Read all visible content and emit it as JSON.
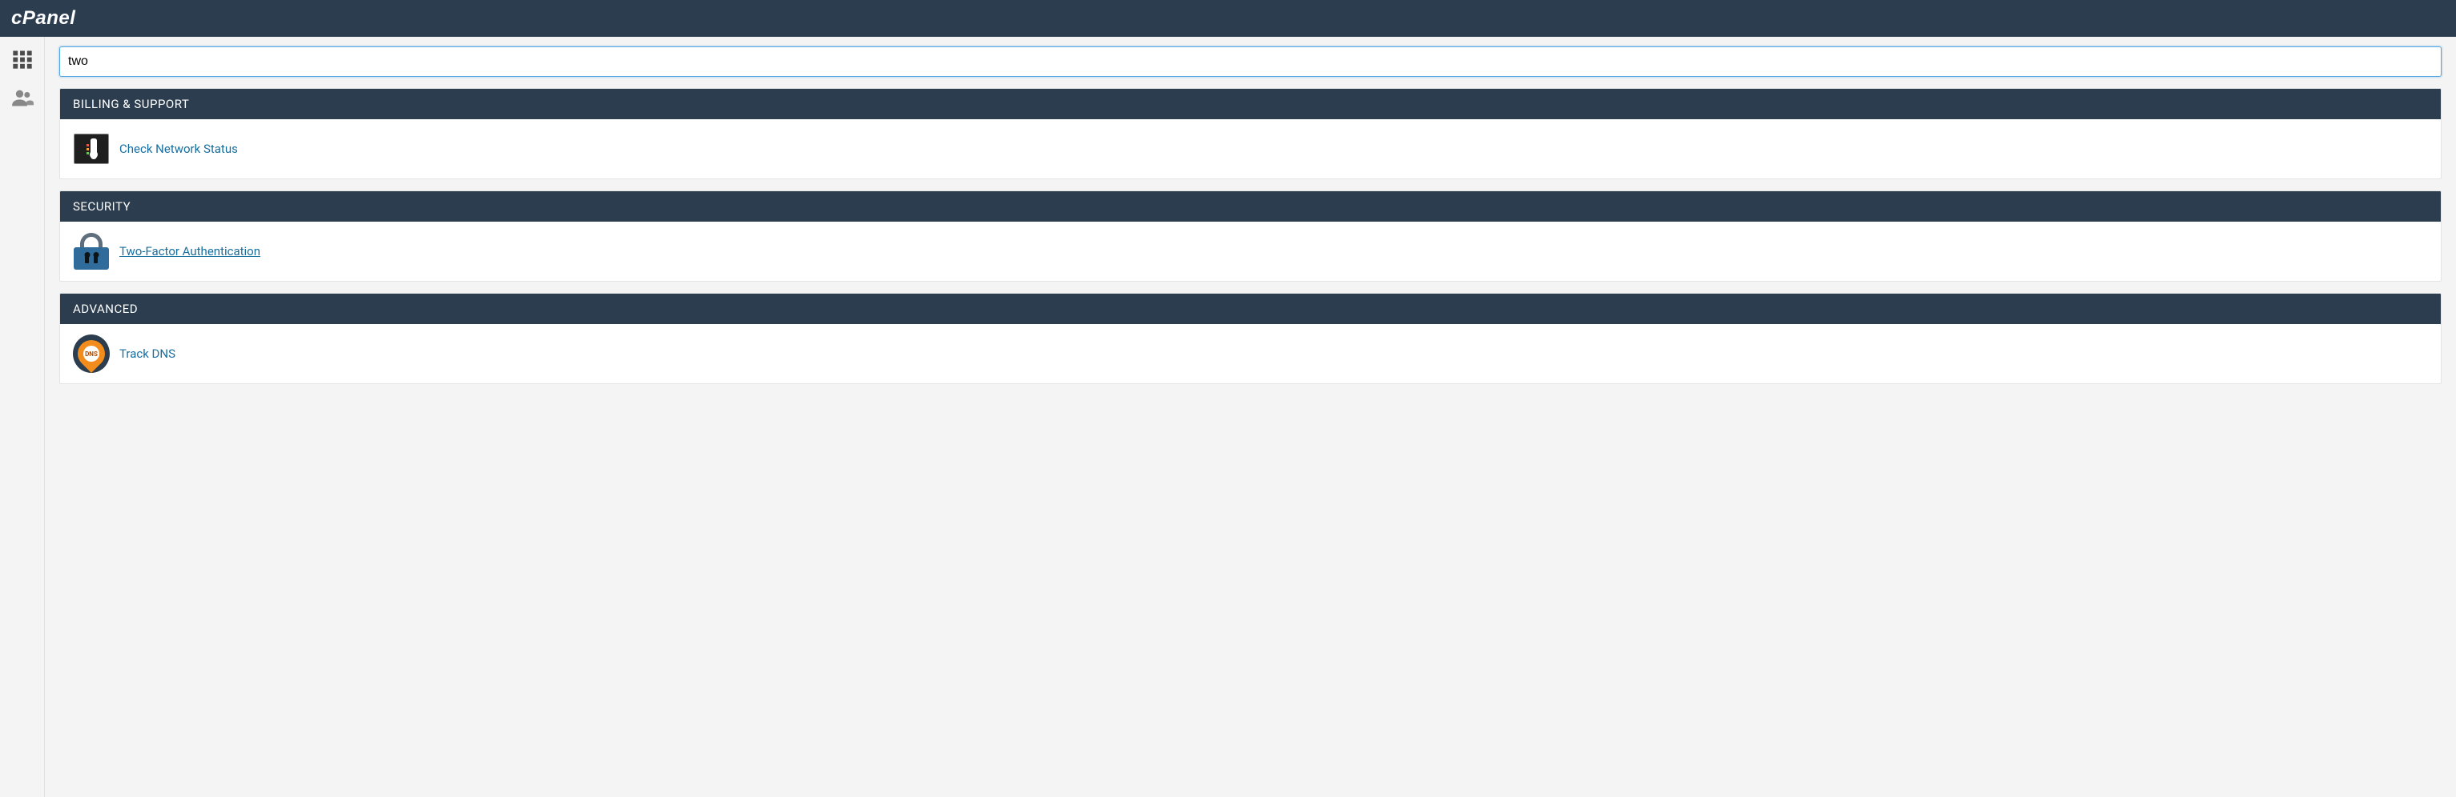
{
  "header": {
    "logo_text": "cPanel"
  },
  "sidebar": {
    "items": [
      {
        "name": "apps-grid"
      },
      {
        "name": "users"
      }
    ]
  },
  "search": {
    "value": "two"
  },
  "groups": [
    {
      "title": "BILLING & SUPPORT",
      "items": [
        {
          "label": "Check Network Status",
          "icon": "network-thermometer",
          "underline": false
        }
      ]
    },
    {
      "title": "SECURITY",
      "items": [
        {
          "label": "Two-Factor Authentication",
          "icon": "lock",
          "underline": true
        }
      ]
    },
    {
      "title": "ADVANCED",
      "items": [
        {
          "label": "Track DNS",
          "icon": "dns-pin",
          "underline": false
        }
      ]
    }
  ]
}
